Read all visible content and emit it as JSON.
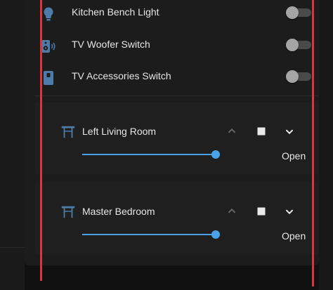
{
  "switches": [
    {
      "label": "Kitchen Bench Light",
      "icon": "lightbulb-icon",
      "state": "off"
    },
    {
      "label": "TV Woofer Switch",
      "icon": "speaker-icon",
      "state": "off"
    },
    {
      "label": "TV Accessories Switch",
      "icon": "switch-icon",
      "state": "off"
    }
  ],
  "covers": [
    {
      "name": "Left Living Room",
      "icon": "blinds-icon",
      "state": "Open",
      "position_percent": 100
    },
    {
      "name": "Master Bedroom",
      "icon": "blinds-icon",
      "state": "Open",
      "position_percent": 100
    }
  ],
  "colors": {
    "accent": "#4aa3e6",
    "icon": "#4d7ca8",
    "highlight_line": "#d8363b",
    "toggle_off_knob": "#a5a5a5",
    "toggle_off_track": "#4a4a4a"
  }
}
